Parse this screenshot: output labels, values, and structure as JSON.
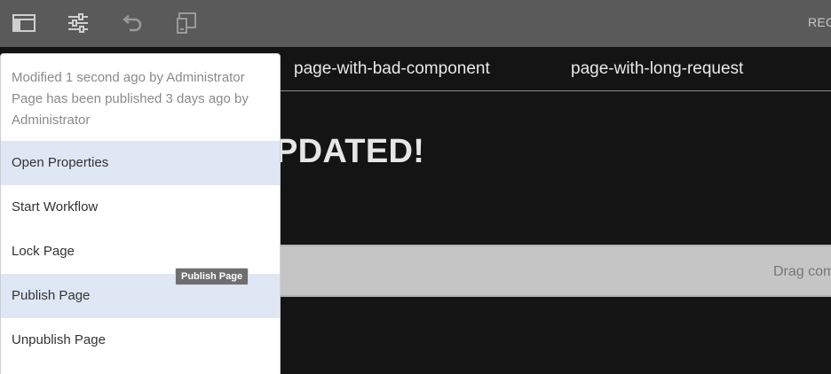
{
  "toolbar": {
    "icons": [
      "side-panel-icon",
      "properties-sliders-icon",
      "undo-icon",
      "emulator-icon"
    ],
    "right_text": "REG"
  },
  "nav": {
    "links": [
      "page-with-bad-component",
      "page-with-long-request"
    ]
  },
  "content": {
    "hero_text": "PDATED!",
    "dropzone_text": "Drag com"
  },
  "page_info": {
    "modified": "Modified 1 second ago by Administrator",
    "published_line1": "Page has been published 3 days ago by",
    "published_line2": "Administrator"
  },
  "menu": {
    "items": [
      "Open Properties",
      "Start Workflow",
      "Lock Page",
      "Publish Page",
      "Unpublish Page"
    ]
  },
  "tooltip": "Publish Page"
}
